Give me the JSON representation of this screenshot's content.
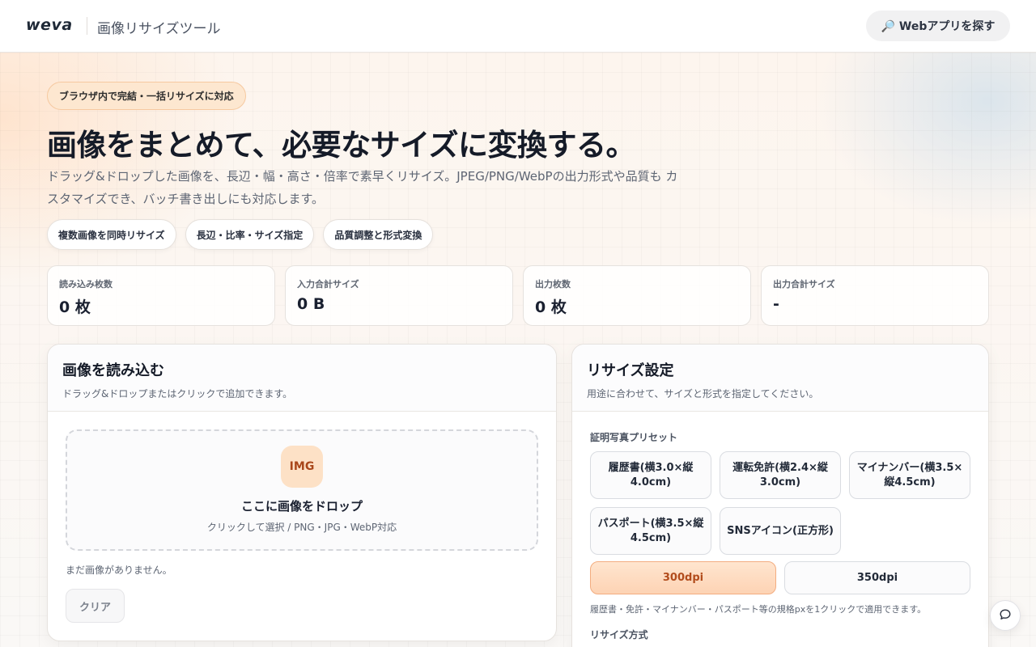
{
  "header": {
    "logo": "weva",
    "app_title": "画像リサイズツール",
    "find_apps_icon": "magnifier-icon",
    "find_apps_label": "🔎 Webアプリを探す"
  },
  "hero": {
    "pill": "ブラウザ内で完結・一括リサイズに対応",
    "title": "画像をまとめて、必要なサイズに変換する。",
    "description": "ドラッグ&ドロップした画像を、長辺・幅・高さ・倍率で素早くリサイズ。JPEG/PNG/WebPの出力形式や品質も カスタマイズでき、バッチ書き出しにも対応します。",
    "chips": [
      "複数画像を同時リサイズ",
      "長辺・比率・サイズ指定",
      "品質調整と形式変換"
    ]
  },
  "stats": [
    {
      "label": "読み込み枚数",
      "value": "0 枚"
    },
    {
      "label": "入力合計サイズ",
      "value": "0 B"
    },
    {
      "label": "出力枚数",
      "value": "0 枚"
    },
    {
      "label": "出力合計サイズ",
      "value": "-"
    }
  ],
  "load_panel": {
    "title": "画像を読み込む",
    "subtitle": "ドラッグ&ドロップまたはクリックで追加できます。",
    "badge": "IMG",
    "drop_title": "ここに画像をドロップ",
    "drop_sub": "クリックして選択 / PNG・JPG・WebP対応",
    "empty": "まだ画像がありません。",
    "clear": "クリア"
  },
  "settings_panel": {
    "title": "リサイズ設定",
    "subtitle": "用途に合わせて、サイズと形式を指定してください。",
    "preset_label": "証明写真プリセット",
    "presets": [
      "履歴書(横3.0×縦4.0cm)",
      "運転免許(横2.4×縦3.0cm)",
      "マイナンバー(横3.5×縦4.5cm)",
      "パスポート(横3.5×縦4.5cm)",
      "SNSアイコン(正方形)"
    ],
    "dpi_options": [
      "300dpi",
      "350dpi"
    ],
    "dpi_selected": "300dpi",
    "preset_note": "履歴書・免許・マイナンバー・パスポート等の規格pxを1クリックで適用できます。",
    "method_label": "リサイズ方式"
  },
  "chat_icon": "chat-bubble-icon",
  "colors": {
    "accent": "#f3ad80",
    "accent_text": "#b24c1c",
    "badge_bg": "#fde1c6"
  }
}
